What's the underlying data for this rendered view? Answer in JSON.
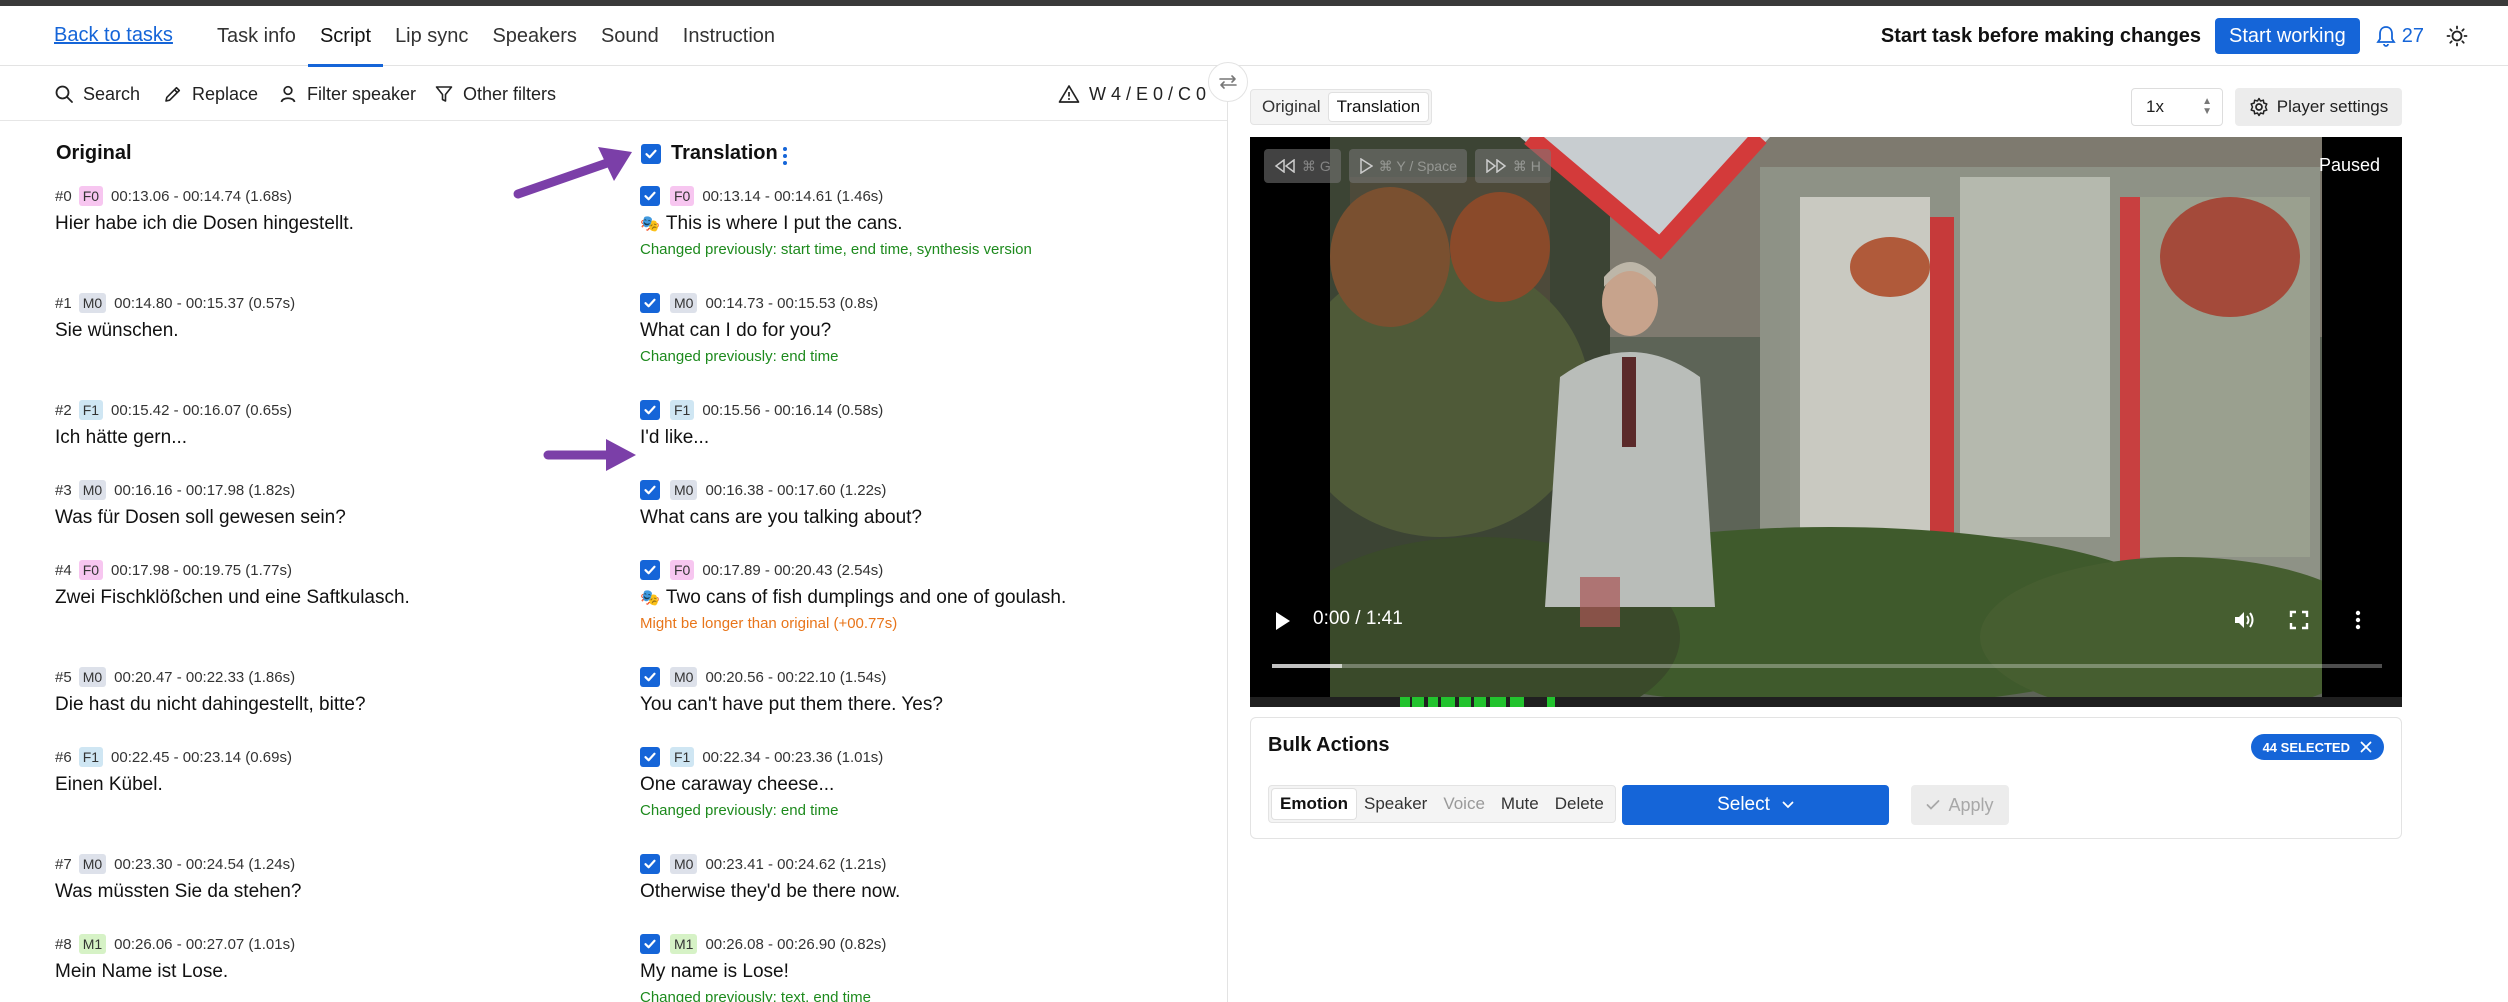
{
  "header": {
    "back_label": "Back to tasks",
    "tabs": [
      {
        "label": "Task info"
      },
      {
        "label": "Script"
      },
      {
        "label": "Lip sync"
      },
      {
        "label": "Speakers"
      },
      {
        "label": "Sound"
      },
      {
        "label": "Instruction"
      }
    ],
    "active_tab": "Script",
    "start_message": "Start task before making changes",
    "start_button": "Start working",
    "notification_count": "27"
  },
  "toolbar": {
    "search": "Search",
    "replace": "Replace",
    "filter_speaker": "Filter speaker",
    "other_filters": "Other filters",
    "warnings": "W 4 / E 0 / C 0"
  },
  "columns": {
    "original": "Original",
    "translation": "Translation"
  },
  "speaker_colors": {
    "F0": "#f7c6f0",
    "M0": "#dde1ea",
    "F1": "#cfe6f3",
    "M1": "#d6f2c6"
  },
  "note_colors": {
    "changed": "#1d8a1d",
    "warning": "#e8751a"
  },
  "segments": [
    {
      "index": "#0",
      "speaker": "F0",
      "orig_time": "00:13.06 - 00:14.74 (1.68s)",
      "orig_text": "Hier habe ich die Dosen hingestellt.",
      "trans_time": "00:13.14 - 00:14.61 (1.46s)",
      "trans_text": "This is where I put the cans.",
      "note": "Changed previously: start time, end time, synthesis version",
      "note_type": "changed"
    },
    {
      "index": "#1",
      "speaker": "M0",
      "orig_time": "00:14.80 - 00:15.37 (0.57s)",
      "orig_text": "Sie wünschen.",
      "trans_time": "00:14.73 - 00:15.53 (0.8s)",
      "trans_text": "What can I do for you?",
      "note": "Changed previously: end time",
      "note_type": "changed"
    },
    {
      "index": "#2",
      "speaker": "F1",
      "orig_time": "00:15.42 - 00:16.07 (0.65s)",
      "orig_text": "Ich hätte gern...",
      "trans_time": "00:15.56 - 00:16.14 (0.58s)",
      "trans_text": "I'd like...",
      "note": "",
      "note_type": ""
    },
    {
      "index": "#3",
      "speaker": "M0",
      "orig_time": "00:16.16 - 00:17.98 (1.82s)",
      "orig_text": "Was für Dosen soll gewesen sein?",
      "trans_time": "00:16.38 - 00:17.60 (1.22s)",
      "trans_text": "What cans are you talking about?",
      "note": "",
      "note_type": ""
    },
    {
      "index": "#4",
      "speaker": "F0",
      "orig_time": "00:17.98 - 00:19.75 (1.77s)",
      "orig_text": "Zwei Fischklößchen und eine Saftkulasch.",
      "trans_time": "00:17.89 - 00:20.43 (2.54s)",
      "trans_text": "Two cans of fish dumplings and one of goulash.",
      "note": "Might be longer than original (+00.77s)",
      "note_type": "warning"
    },
    {
      "index": "#5",
      "speaker": "M0",
      "orig_time": "00:20.47 - 00:22.33 (1.86s)",
      "orig_text": "Die hast du nicht dahingestellt, bitte?",
      "trans_time": "00:20.56 - 00:22.10 (1.54s)",
      "trans_text": "You can't have put them there. Yes?",
      "note": "",
      "note_type": ""
    },
    {
      "index": "#6",
      "speaker": "F1",
      "orig_time": "00:22.45 - 00:23.14 (0.69s)",
      "orig_text": "Einen Kübel.",
      "trans_time": "00:22.34 - 00:23.36 (1.01s)",
      "trans_text": "One caraway cheese...",
      "note": "Changed previously: end time",
      "note_type": "changed"
    },
    {
      "index": "#7",
      "speaker": "M0",
      "orig_time": "00:23.30 - 00:24.54 (1.24s)",
      "orig_text": "Was müssten Sie da stehen?",
      "trans_time": "00:23.41 - 00:24.62 (1.21s)",
      "trans_text": "Otherwise they'd be there now.",
      "note": "",
      "note_type": ""
    },
    {
      "index": "#8",
      "speaker": "M1",
      "orig_time": "00:26.06 - 00:27.07 (1.01s)",
      "orig_text": "Mein Name ist Lose.",
      "trans_time": "00:26.08 - 00:26.90 (0.82s)",
      "trans_text": "My name is Lose!",
      "note": "Changed previously: text, end time",
      "note_type": "changed"
    }
  ],
  "player": {
    "view_original": "Original",
    "view_translation": "Translation",
    "speed": "1x",
    "settings": "Player settings",
    "status": "Paused",
    "rewind_hint": "⌘ G",
    "play_hint": "⌘ Y / Space",
    "forward_hint": "⌘ H",
    "time": "0:00 / 1:41"
  },
  "bulk": {
    "title": "Bulk Actions",
    "selected": "44 SELECTED",
    "tabs": [
      "Emotion",
      "Speaker",
      "Voice",
      "Mute",
      "Delete"
    ],
    "select_label": "Select",
    "apply_label": "Apply"
  },
  "accent": "#1565d8",
  "arrow_color": "#7b3fa8"
}
